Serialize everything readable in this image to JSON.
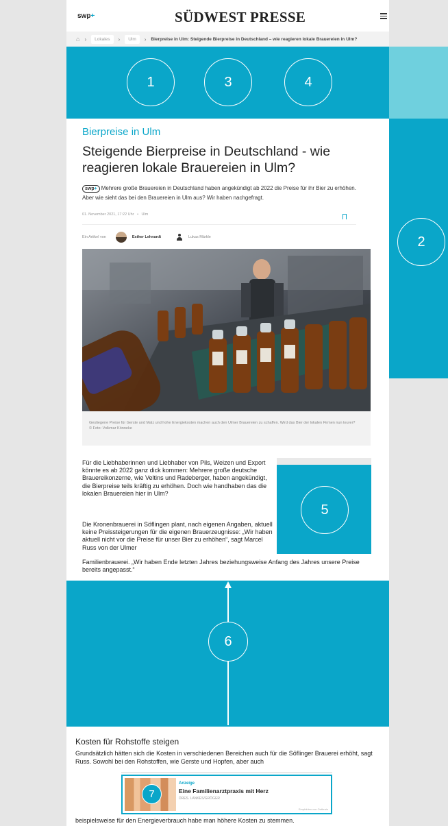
{
  "header": {
    "logo_small": "swp",
    "logo_small_plus": "+",
    "logo_main": "SÜDWEST PRESSE",
    "menu_icon": "hamburger-icon"
  },
  "breadcrumb": {
    "home_icon": "home-icon",
    "items": [
      "Lokales",
      "Ulm"
    ],
    "current": "Bierpreise in Ulm: Steigende Bierpreise in Deutschland – wie reagieren lokale Brauereien in Ulm?"
  },
  "ad_slots": [
    "1",
    "3",
    "4",
    "2",
    "5",
    "6",
    "7"
  ],
  "article": {
    "kicker": "Bierpreise in Ulm",
    "headline": "Steigende Bierpreise in Deutschland - wie reagieren lokale Brauereien in Ulm?",
    "badge": "swp",
    "badge_plus": "+",
    "lead": "Mehrere große Brauereien in Deutschland haben angekündigt ab 2022 die Preise für ihr Bier zu erhöhen. Aber wie sieht das bei den Brauereien in Ulm aus? Wir haben nachgefragt.",
    "date": "01. November 2021, 17:22 Uhr",
    "location": "Ulm",
    "meta_sep": "•",
    "authors_label": "Ein Artikel von",
    "author1": "Esther Lehnardt",
    "author2": "Lukas Märkle",
    "caption": "Gestiegene Preise für Gerste und Malz und hohe Energiekosten machen auch den Ulmer Brauereien zu schaffen. Wird das Bier der lokalen Firmen nun teurer?",
    "photo_credit": "© Foto: Volkmar Könneke",
    "para1": "Für die Liebhaberinnen und Liebhaber von Pils, Weizen und Export könnte es ab 2022 ganz dick kommen: Mehrere große deutsche Brauereikonzerne, wie Veltins und Radeberger, haben angekündigt, die Bierpreise teils kräftig zu erhöhen. Doch wie handhaben das die lokalen Brauereien hier in Ulm?",
    "para2": "Die Kronenbrauerei in Söflingen plant, nach eigenen Angaben, aktuell keine Preissteigerungen für die eigenen Brauerzeugnisse: „Wir haben aktuell nicht vor die Preise für unser Bier zu erhöhen“, sagt Marcel Russ von der Ulmer",
    "para2_tail": "Familienbrauerei. „Wir haben Ende letzten Jahres beziehungsweise Anfang des Jahres unsere Preise bereits angepasst.“",
    "section_title": "Kosten für Rohstoffe steigen",
    "para3": "Grundsätzlich hätten sich die Kosten in verschiedenen Bereichen auch für die Söflinger Brauerei erhöht, sagt Russ. Sowohl bei den Rohstoffen, wie Gerste und Hopfen, aber auch",
    "para4": "beispielsweise für den Energieverbrauch habe man höhere Kosten zu stemmen."
  },
  "promo": {
    "tag": "Anzeige",
    "title": "Eine Familienarztpraxis mit Herz",
    "sub": "DRES. LANKES/GRÖGER",
    "credit": "Empfohlen von Outbrain"
  }
}
